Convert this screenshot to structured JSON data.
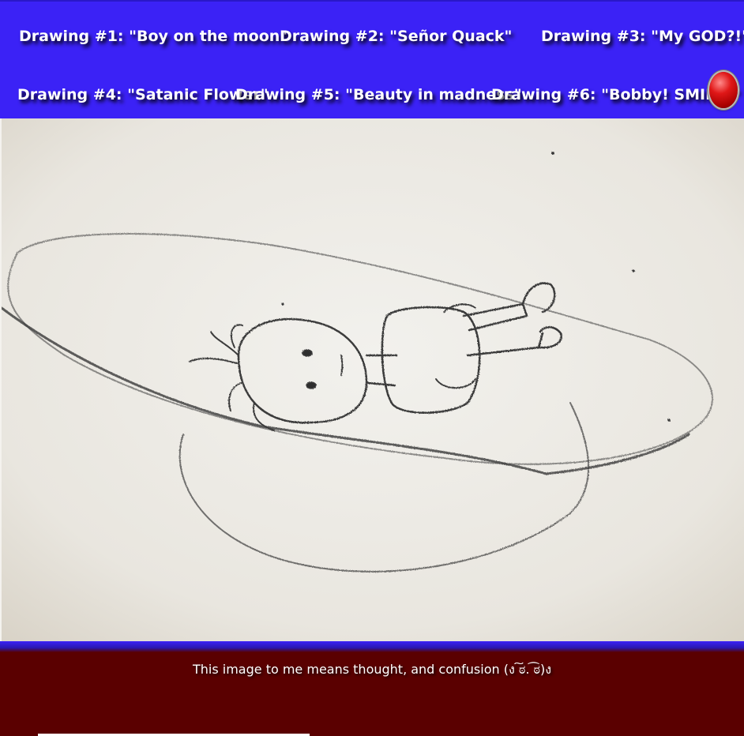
{
  "nav": {
    "items": [
      {
        "label": "Drawing #1: \"Boy on the moon\""
      },
      {
        "label": "Drawing #2: \"Señor Quack\""
      },
      {
        "label": "Drawing #3: \"My GOD?!\""
      },
      {
        "label": "Drawing #4: \"Satanic Flower\""
      },
      {
        "label": "Drawing #5: \"Beauty in madness\""
      },
      {
        "label": "Drawing #6: \"Bobby! SMILE!\""
      }
    ],
    "action_icon": "red-circle-button-icon"
  },
  "colors": {
    "nav_bg": "#3b22f6",
    "footer_bg": "#5a0000",
    "text": "#ffffff"
  },
  "main": {
    "image_subject": "pencil drawing of a boy lying on a moon-like planet with a ring"
  },
  "footer": {
    "caption": "This image to me means thought, and confusion (ง ͠ಠ. ͡ಠ)ง"
  }
}
